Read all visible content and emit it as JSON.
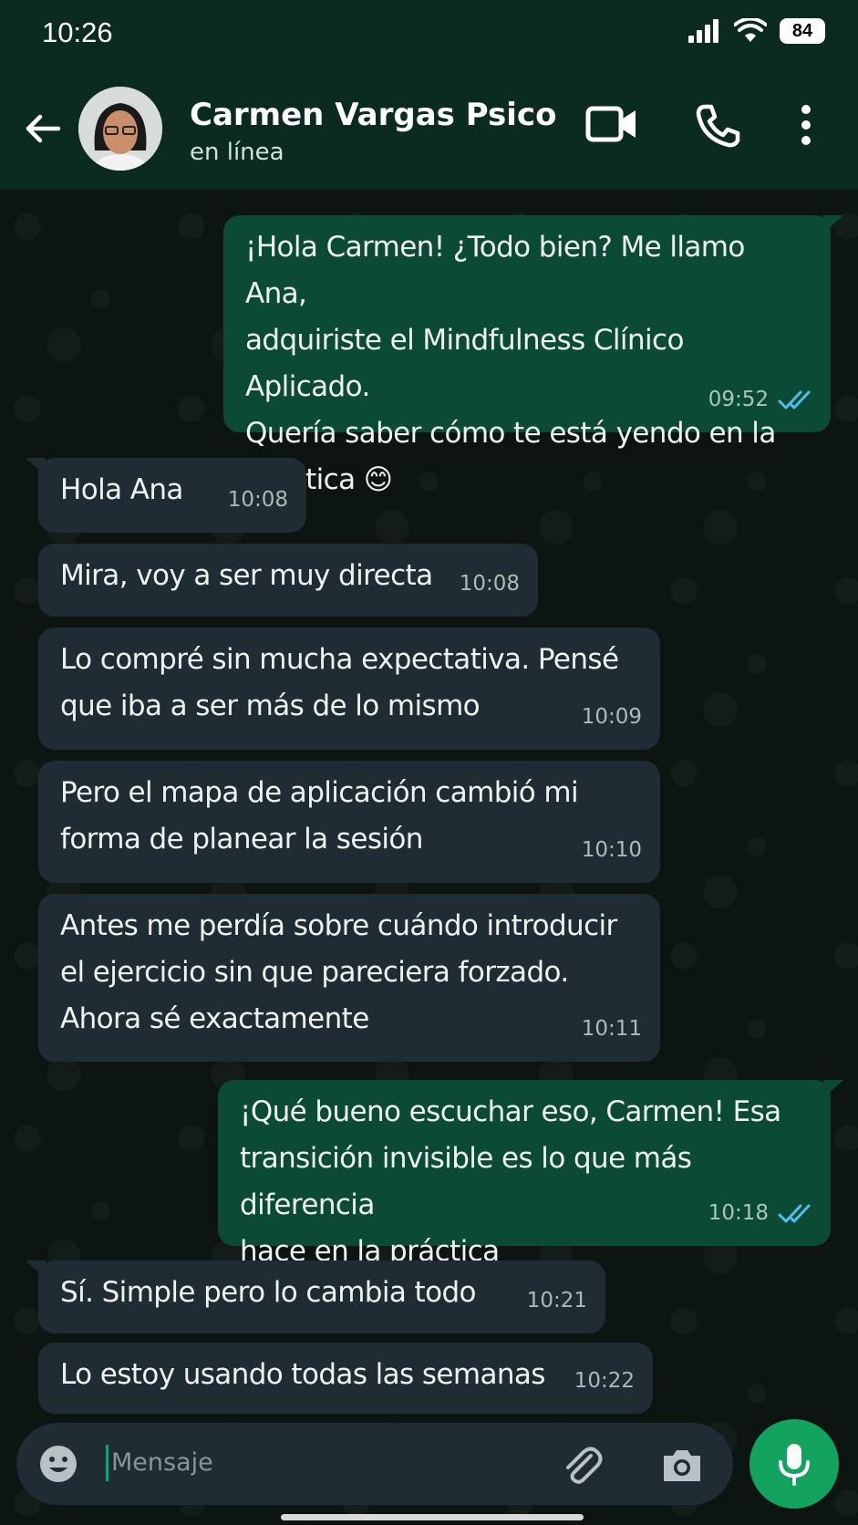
{
  "status_bar": {
    "time": "10:26",
    "battery": "84"
  },
  "header": {
    "contact_name": "Carmen Vargas Psico",
    "status": "en línea"
  },
  "messages": [
    {
      "dir": "out",
      "text": "¡Hola Carmen! ¿Todo bien? Me llamo Ana,\nadquiriste el Mindfulness Clínico Aplicado.\nQuería saber cómo te está yendo en la\npráctica 😊",
      "time": "09:52"
    },
    {
      "dir": "in",
      "text": "Hola Ana",
      "time": "10:08"
    },
    {
      "dir": "in",
      "text": "Mira, voy a ser muy directa",
      "time": "10:08"
    },
    {
      "dir": "in",
      "text": "Lo compré sin mucha expectativa. Pensé\nque iba a ser más de lo mismo",
      "time": "10:09"
    },
    {
      "dir": "in",
      "text": "Pero el mapa de aplicación cambió mi\nforma de planear la sesión",
      "time": "10:10"
    },
    {
      "dir": "in",
      "text": "Antes me perdía sobre cuándo introducir\nel ejercicio sin que pareciera forzado.\nAhora sé exactamente",
      "time": "10:11"
    },
    {
      "dir": "out",
      "text": "¡Qué bueno escuchar eso, Carmen! Esa\ntransición invisible es lo que más diferencia\nhace en la práctica",
      "time": "10:18"
    },
    {
      "dir": "in",
      "text": "Sí. Simple pero lo cambia todo",
      "time": "10:21"
    },
    {
      "dir": "in",
      "text": "Lo estoy usando todas las semanas",
      "time": "10:22"
    }
  ],
  "composer": {
    "placeholder": "Mensaje"
  },
  "colors": {
    "header_bg": "#0a2a22",
    "incoming_bubble": "#1f2c33",
    "outgoing_bubble": "#0b4a35",
    "read_ticks": "#53bdeb",
    "mic_button": "#12a35f"
  }
}
